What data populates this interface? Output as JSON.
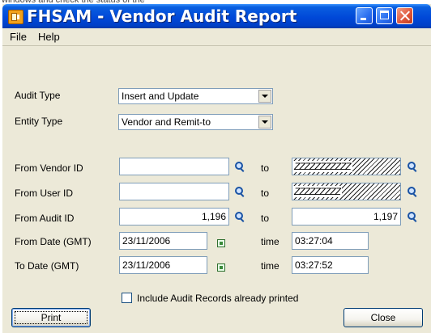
{
  "background": {
    "text": "windows and check the status of the"
  },
  "window": {
    "title": "FHSAM - Vendor Audit Report"
  },
  "menu": {
    "file": "File",
    "help": "Help"
  },
  "audit_type": {
    "label": "Audit Type",
    "value": "Insert and Update"
  },
  "entity_type": {
    "label": "Entity Type",
    "value": "Vendor and Remit-to"
  },
  "vendor_id": {
    "label": "From Vendor ID",
    "from_value": "",
    "to_label": "to",
    "to_value": "ZZZZZZZZZZZ"
  },
  "user_id": {
    "label": "From User ID",
    "from_value": "",
    "to_label": "to",
    "to_value": "ZZZZZZZZZ"
  },
  "audit_id": {
    "label": "From Audit ID",
    "from_value": "1,196",
    "to_label": "to",
    "to_value": "1,197"
  },
  "from_date": {
    "label": "From Date (GMT)",
    "date": "23/11/2006",
    "time_label": "time",
    "time": "03:27:04"
  },
  "to_date": {
    "label": "To Date (GMT)",
    "date": "23/11/2006",
    "time_label": "time",
    "time": "03:27:52"
  },
  "include_printed": {
    "label": "Include Audit Records already printed",
    "checked": false
  },
  "buttons": {
    "print": "Print",
    "close": "Close"
  },
  "colors": {
    "titlebar": "#0048d8",
    "window_bg": "#ece9d8",
    "field_border": "#7f9db9"
  }
}
